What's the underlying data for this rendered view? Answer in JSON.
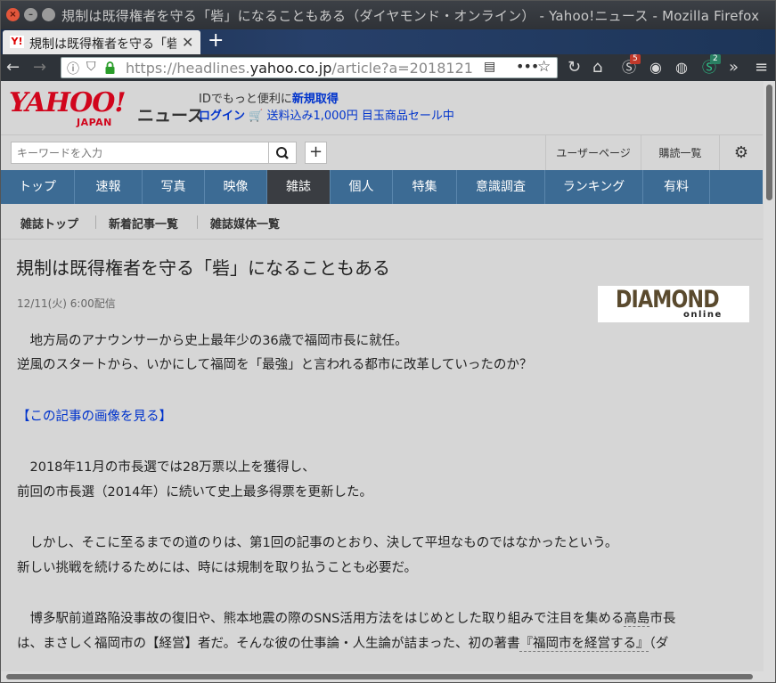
{
  "window": {
    "title": "規制は既得権者を守る「砦」になることもある（ダイヤモンド・オンライン） - Yahoo!ニュース - Mozilla Firefox"
  },
  "tab": {
    "title": "規制は既得権者を守る「砦",
    "favicon": "Y!"
  },
  "url": {
    "prefix": "https://headlines.",
    "domain": "yahoo.co.jp",
    "path": "/article?a=20181211-",
    "badge_count_1": "5",
    "badge_count_2": "2"
  },
  "header": {
    "logo_main": "YAHOO!",
    "logo_sub": "JAPAN",
    "logo_news": "ニュース",
    "line1_text": "IDでもっと便利に",
    "line1_link": "新規取得",
    "login": "ログイン",
    "promo": "送料込み1,000円 目玉商品セール中"
  },
  "search": {
    "placeholder": "キーワードを入力",
    "plus": "+"
  },
  "utility": {
    "user_page": "ユーザーページ",
    "subscriptions": "購読一覧"
  },
  "gnav": {
    "items": [
      "トップ",
      "速報",
      "写真",
      "映像",
      "雑誌",
      "個人",
      "特集",
      "意識調査",
      "ランキング",
      "有料"
    ],
    "active": "雑誌"
  },
  "subnav": {
    "items": [
      "雑誌トップ",
      "新着記事一覧",
      "雑誌媒体一覧"
    ]
  },
  "article": {
    "title": "規制は既得権者を守る「砦」になることもある",
    "date": "12/11(火) 6:00配信",
    "publisher_logo_main": "DIAMOND",
    "publisher_logo_sub": "online",
    "p1_l1": "　地方局のアナウンサーから史上最年少の36歳で福岡市長に就任。",
    "p1_l2": "逆風のスタートから、いかにして福岡を「最強」と言われる都市に改革していったのか？",
    "image_link": "【この記事の画像を見る】",
    "p2_l1": "　2018年11月の市長選では28万票以上を獲得し、",
    "p2_l2": "前回の市長選（2014年）に続いて史上最多得票を更新した。",
    "p3_l1": "　しかし、そこに至るまでの道のりは、第1回の記事のとおり、決して平坦なものではなかったという。",
    "p3_l2": "新しい挑戦を続けるためには、時には規制を取り払うことも必要だ。",
    "p4_l1_a": "　博多駅前道路陥没事故の復旧や、熊本地震の際のSNS活用方法をはじめとした取り組みで注目を集める",
    "p4_l1_b": "高島",
    "p4_l1_c": "市長",
    "p4_l2_a": "は、まさしく福岡市の【経営】者だ。そんな彼の仕事論・人生論が詰まった、初の著書",
    "p4_l2_b": "『福岡市を経営する』",
    "p4_l2_c": "（ダ"
  }
}
